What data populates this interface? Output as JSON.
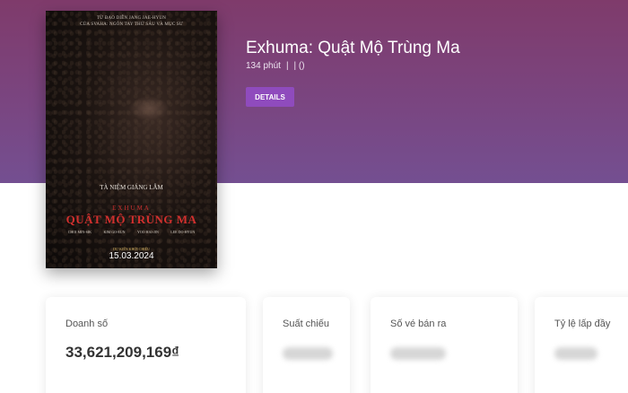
{
  "movie": {
    "title": "Exhuma: Quật Mộ Trùng Ma",
    "duration": "134 phút",
    "meta_separator": "|",
    "rating": "| ()",
    "details_label": "DETAILS"
  },
  "poster": {
    "credit_line1": "TỪ ĐẠO DIỄN JANG JAE-HYUN",
    "credit_line2": "CỦA SVAHA: NGÓN TAY THỨ SÁU VÀ MỤC SƯ",
    "tagline": "TÀ NIỆM GIÁNG LÂM",
    "title_en": "EXHUMA",
    "title_vi": "QUẬT MỘ TRÙNG MA",
    "cast": [
      "CHOI MIN-SIK",
      "KIM GO-EUN",
      "YOO HAI-JIN",
      "LEE DO-HYUN"
    ],
    "release_label": "DỰ KIẾN KHỞI CHIẾU",
    "release_date": "15.03.2024"
  },
  "stats": {
    "revenue_label": "Doanh số",
    "revenue_value": "33,621,209,169₫",
    "showtimes_label": "Suất chiếu",
    "tickets_label": "Số vé bán ra",
    "occupancy_label": "Tỷ lệ lấp đầy"
  }
}
